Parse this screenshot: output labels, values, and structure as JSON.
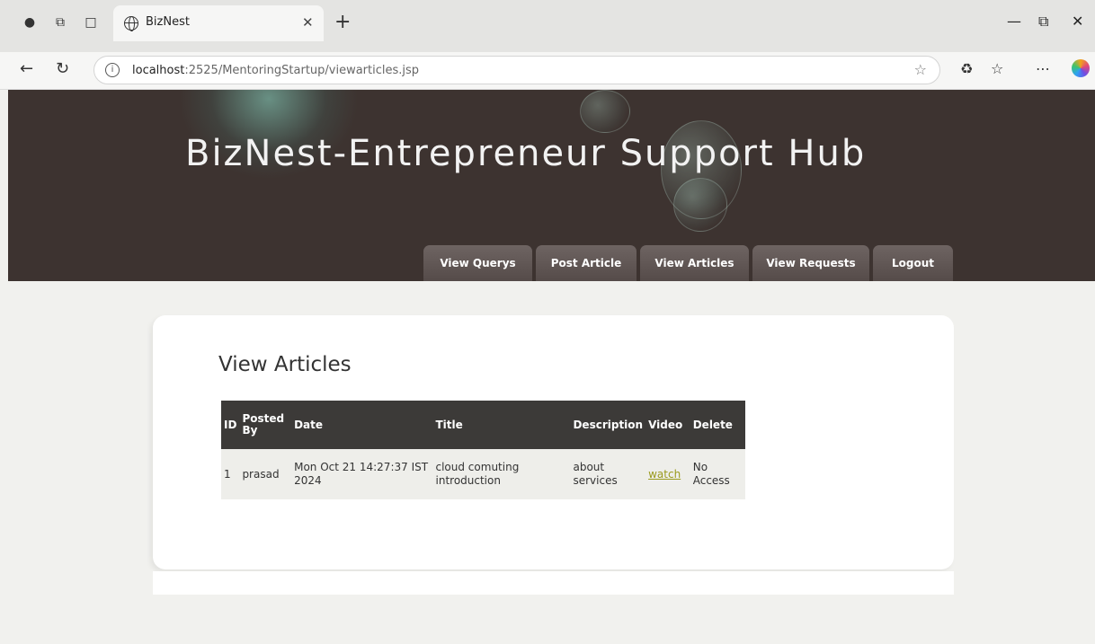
{
  "browser": {
    "tab_title": "BizNest",
    "url_host": "localhost",
    "url_rest": ":2525/MentoringStartup/viewarticles.jsp"
  },
  "site": {
    "title": "BizNest-Entrepreneur Support Hub"
  },
  "menu": [
    {
      "label": "View Querys"
    },
    {
      "label": "Post Article"
    },
    {
      "label": "View Articles"
    },
    {
      "label": "View Requests"
    },
    {
      "label": "Logout"
    }
  ],
  "content": {
    "heading": "View Articles"
  },
  "table": {
    "headers": [
      "ID",
      "Posted By",
      "Date",
      "Title",
      "Description",
      "Video",
      "Delete"
    ],
    "rows": [
      {
        "id": "1",
        "posted_by": "prasad",
        "date": "Mon Oct 21 14:27:37 IST 2024",
        "title": "cloud comuting introduction",
        "description": "about services",
        "video": "watch",
        "delete": "No Access"
      }
    ]
  }
}
